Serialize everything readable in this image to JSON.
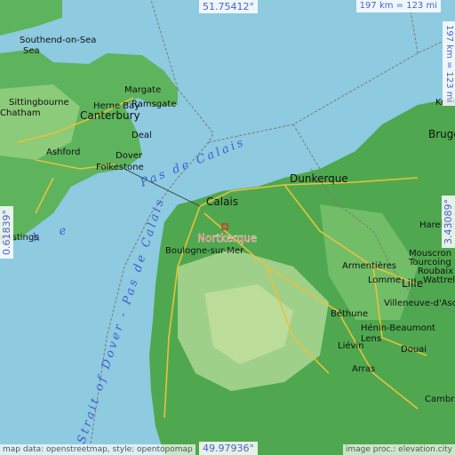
{
  "map": {
    "highlight": "Nortkerque",
    "coords": {
      "top": "51.75412°",
      "bottom": "49.97936°",
      "left": "0.61839°",
      "right": "3.43089°"
    },
    "scale": {
      "top": "197 km = 123 mi",
      "right": "197 km = 123 mi"
    },
    "attribution": {
      "left": "map data: openstreetmap, style: opentopomap",
      "right": "image proc.: elevation.city"
    },
    "water_labels": {
      "pas_de_calais": "Pas de Calais",
      "strait": "Strait of Dover - Pas de Calais",
      "the": "he"
    },
    "places": [
      {
        "name": "Southend-on-Sea",
        "line2": "Sea"
      },
      {
        "name": "Margate"
      },
      {
        "name": "Herne Bay"
      },
      {
        "name": "Ramsgate"
      },
      {
        "name": "Sittingbourne"
      },
      {
        "name": "Canterbury"
      },
      {
        "name": "Deal"
      },
      {
        "name": "Dover"
      },
      {
        "name": "Ashford"
      },
      {
        "name": "Folkestone"
      },
      {
        "name": "Calais"
      },
      {
        "name": "Dunkerque"
      },
      {
        "name": "Knokke"
      },
      {
        "name": "Brugge"
      },
      {
        "name": "Boulogne-sur-Mer"
      },
      {
        "name": "Harelbeke"
      },
      {
        "name": "Mouscron"
      },
      {
        "name": "Tourcoing"
      },
      {
        "name": "Roubaix"
      },
      {
        "name": "Wattrelos"
      },
      {
        "name": "Armentières"
      },
      {
        "name": "Lomme"
      },
      {
        "name": "Lille"
      },
      {
        "name": "Villeneuve-d'Ascq"
      },
      {
        "name": "Béthune"
      },
      {
        "name": "Hénin-Beaumont"
      },
      {
        "name": "Lens"
      },
      {
        "name": "Liévin"
      },
      {
        "name": "Douai"
      },
      {
        "name": "Arras"
      },
      {
        "name": "Cambrai"
      },
      {
        "name": "Chatham"
      },
      {
        "name": "Hastings"
      }
    ],
    "colors": {
      "sea": "#8ecae0",
      "land": "#5cb85c",
      "highland": "#a8d08d",
      "roads": "#e8c23a",
      "border": "#7a7a7a",
      "highlight": "#e03030"
    }
  }
}
